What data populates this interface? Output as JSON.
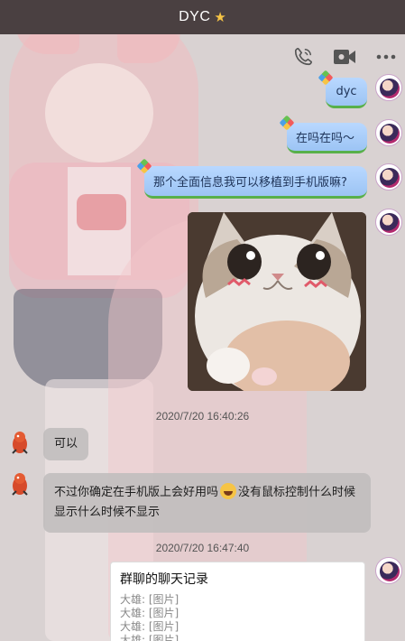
{
  "window": {
    "title": "DYC",
    "title_badge": "star-icon"
  },
  "toolbar": {
    "items": [
      "phone-icon",
      "video-icon",
      "more-icon"
    ]
  },
  "messages": {
    "m1": "dyc",
    "m2": "在吗在吗～",
    "m3": "那个全面信息我可以移植到手机版嘛?",
    "ts1": "2020/7/20 16:40:26",
    "m4": "可以",
    "m5_a": "不过你确定在手机版上会好用吗",
    "m5_b": "没有鼠标控制什么时候",
    "m5_c": "显示什么时候不显示",
    "ts2": "2020/7/20 16:47:40"
  },
  "forward_card": {
    "title": "群聊的聊天记录",
    "lines": [
      "大雄: [图片]",
      "大雄: [图片]",
      "大雄: [图片]",
      "大雄: [图片]"
    ]
  },
  "colors": {
    "titlebar": "#4a4041",
    "bubble_me": "#a9cdf8",
    "bubble_them": "#bebcbc",
    "accent_star": "#f6c445"
  }
}
